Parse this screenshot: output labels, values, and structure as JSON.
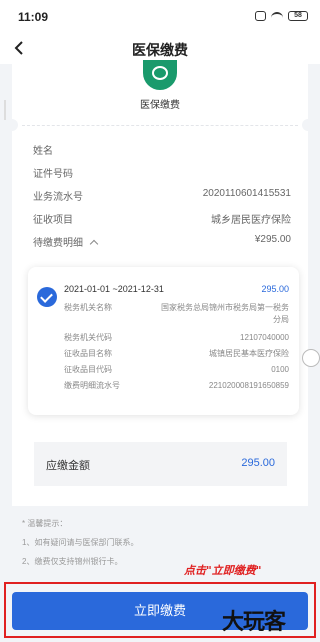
{
  "status_bar": {
    "time": "11:09",
    "battery": "58"
  },
  "nav": {
    "title": "医保缴费"
  },
  "service": {
    "name": "医保缴费"
  },
  "fields": [
    {
      "label": "姓名",
      "value": ""
    },
    {
      "label": "证件号码",
      "value": ""
    },
    {
      "label": "业务流水号",
      "value": "2020110601415531"
    },
    {
      "label": "征收项目",
      "value": "城乡居民医疗保险"
    },
    {
      "label": "待缴费明细",
      "value": "¥295.00"
    }
  ],
  "detail": {
    "period": "2021-01-01 ~2021-12-31",
    "amount": "295.00",
    "rows": [
      {
        "label": "税务机关名称",
        "value": "国家税务总局锦州市税务局第一税务分局"
      },
      {
        "label": "税务机关代码",
        "value": "12107040000"
      },
      {
        "label": "征收品目名称",
        "value": "城镇居民基本医疗保险"
      },
      {
        "label": "征收品目代码",
        "value": "0100"
      },
      {
        "label": "缴费明细流水号",
        "value": "22102000819165085​9"
      }
    ]
  },
  "total": {
    "label": "应缴金额",
    "value": "295.00"
  },
  "tips": {
    "title": "* 温馨提示：",
    "lines": [
      "1、如有疑问请与医保部门联系。",
      "2、缴费仅支持锦州银行卡。"
    ]
  },
  "annotation": "点击\"立即缴费\"",
  "pay_button": "立即缴费",
  "watermark": "大玩客",
  "colors": {
    "primary": "#2a69db",
    "logo": "#1a9a6c",
    "annotation": "#e02020"
  }
}
